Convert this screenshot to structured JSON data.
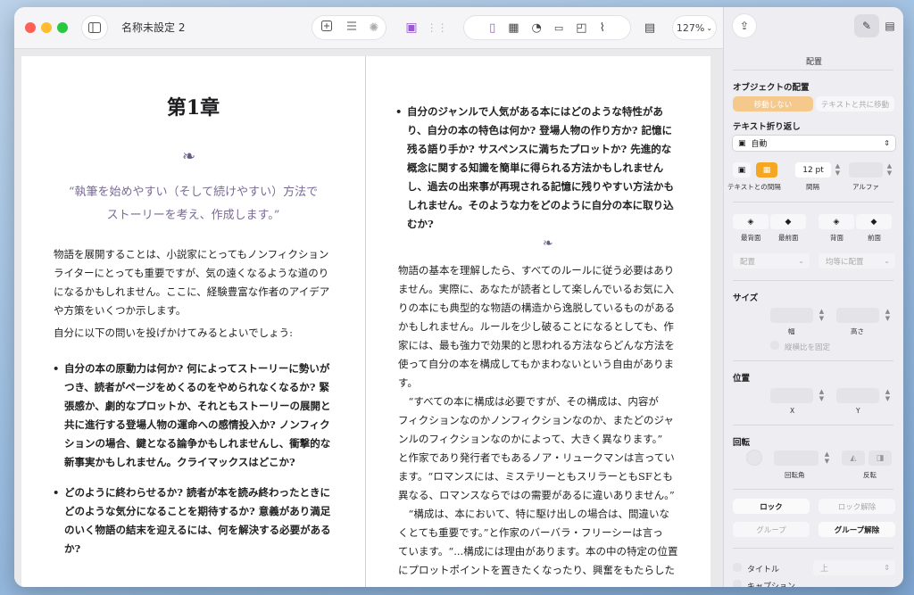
{
  "window": {
    "title": "名称未設定 2",
    "zoom": "127%"
  },
  "document": {
    "left_page": {
      "chapter": "第1章",
      "quote": [
        "“執筆を始めやすい（そして続けやすい）方法で",
        "ストーリーを考え、作成します。”"
      ],
      "intro": [
        "物語を展開することは、小説家にとってもノンフィクション",
        "ライターにとっても重要ですが、気の遠くなるような道のり",
        "になるかもしれません。ここに、経験豊富な作者のアイデア",
        "や方策をいくつか示します。"
      ],
      "question_intro": "自分に以下の問いを投げかけてみるとよいでしょう:",
      "bullet1": [
        "自分の本の原動力は何か? 何によってストーリーに勢いが",
        "つき、読者がページをめくるのをやめられなくなるか? 緊",
        "張感か、劇的なプロットか、それともストーリーの展開と",
        "共に進行する登場人物の運命への感情投入か? ノンフィク",
        "ションの場合、鍵となる論争かもしれませんし、衝撃的な",
        "新事実かもしれません。クライマックスはどこか?"
      ],
      "bullet2": [
        "どのように終わらせるか? 読者が本を読み終わったときに",
        "どのような気分になることを期待するか? 意義があり満足",
        "のいく物語の結末を迎えるには、何を解決する必要がある",
        "か?"
      ]
    },
    "right_page": {
      "bullet": [
        "自分のジャンルで人気がある本にはどのような特性があ",
        "り、自分の本の特色は何か? 登場人物の作り方か? 記憶に",
        "残る語り手か? サスペンスに満ちたプロットか? 先進的な",
        "概念に関する知識を簡単に得られる方法かもしれません",
        "し、過去の出来事が再現される記憶に残りやすい方法かも",
        "しれません。そのような力をどのように自分の本に取り込",
        "むか?"
      ],
      "para1": [
        "物語の基本を理解したら、すべてのルールに従う必要はあり",
        "ません。実際に、あなたが読者として楽しんでいるお気に入",
        "りの本にも典型的な物語の構造から逸脱しているものがある",
        "かもしれません。ルールを少し破ることになるとしても、作",
        "家には、最も強力で効果的と思われる方法ならどんな方法を",
        "使って自分の本を構成してもかまわないという自由がありま",
        "す。"
      ],
      "para2": [
        "　“すべての本に構成は必要ですが、その構成は、内容が",
        "フィクションなのかノンフィクションなのか、またどのジャ",
        "ンルのフィクションなのかによって、大きく異なります。”",
        "と作家であり発行者でもあるノア・リュークマンは言ってい",
        "ます。“ロマンスには、ミステリーともスリラーともSFとも",
        "異なる、ロマンスならではの需要があるに違いありません。”"
      ],
      "para3": [
        "　“構成は、本において、特に駆け出しの場合は、間違いな",
        "くとても重要です。”と作家のバーバラ・フリーシーは言っ",
        "ています。“...構成には理由があります。本の中の特定の位置",
        "にプロットポイントを置きたくなったり、興奮をもたらした"
      ]
    }
  },
  "inspector": {
    "tab_title": "配置",
    "object_placement_label": "オブジェクトの配置",
    "stay_on_page": "移動しない",
    "move_with_text": "テキストと共に移動",
    "text_wrap_label": "テキスト折り返し",
    "text_wrap_value": "自動",
    "text_gap_label": "テキストとの間隔",
    "spacing_value": "12 pt",
    "spacing_label": "間隔",
    "alpha_label": "アルファ",
    "back_label": "最背面",
    "front_label": "最前面",
    "backward_label": "背面",
    "forward_label": "前面",
    "align_label": "配置",
    "distribute_label": "均等に配置",
    "size_label": "サイズ",
    "width_label": "幅",
    "height_label": "高さ",
    "constrain_label": "縦横比を固定",
    "position_label": "位置",
    "x_label": "X",
    "y_label": "Y",
    "rotate_label": "回転",
    "angle_label": "回転角",
    "flip_label": "反転",
    "lock_button": "ロック",
    "unlock_button": "ロック解除",
    "group_button": "グループ",
    "ungroup_button": "グループ解除",
    "title_checkbox": "タイトル",
    "title_position": "上",
    "caption_checkbox": "キャプション"
  },
  "colors": {
    "accent_orange": "#f5a623",
    "quote_purple": "#7a6a96"
  }
}
